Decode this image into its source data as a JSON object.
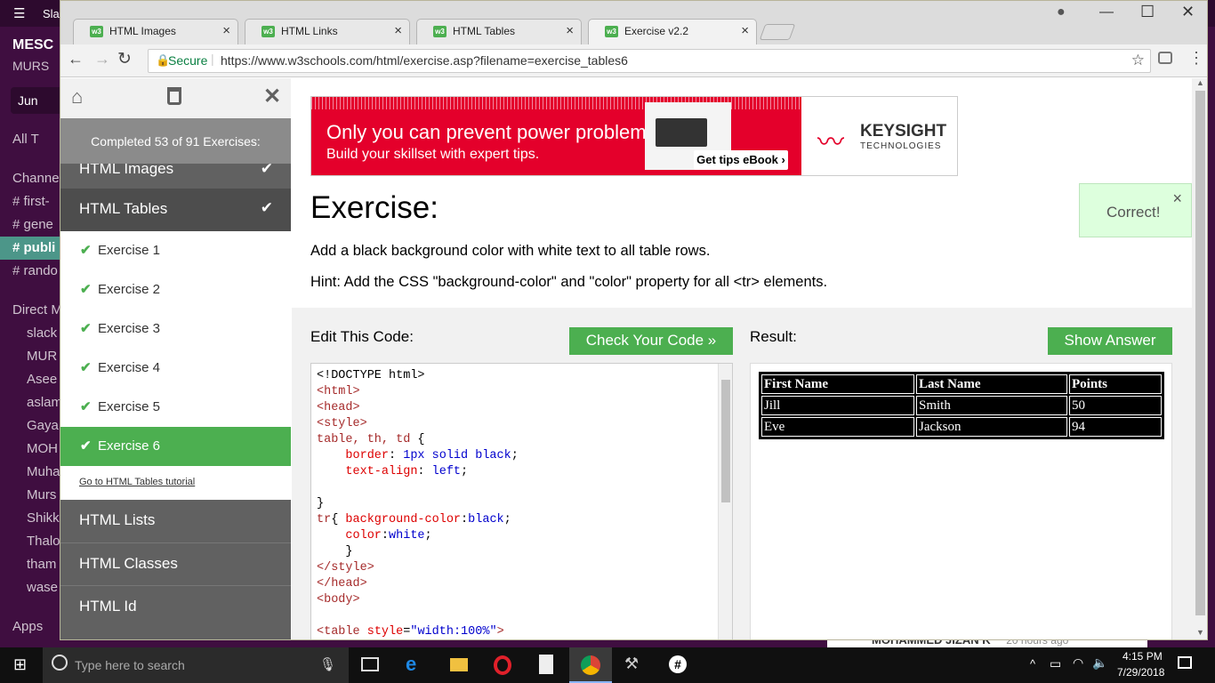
{
  "slack": {
    "workspace_title": "Sla",
    "team": "MESC",
    "user": "MURS",
    "jump": "Jun",
    "all_threads": "All T",
    "channels_header": "Channe",
    "channels": [
      "# first-",
      "# gene",
      "# publi",
      "# rando"
    ],
    "dm_header": "Direct M",
    "dms": [
      "slack",
      "MUR",
      "Asee",
      "aslam",
      "Gaya",
      "MOH",
      "Muha",
      "Murs",
      "Shikk",
      "Thalo",
      "tham",
      "wase"
    ],
    "apps": "Apps",
    "bottom_name": "MOHAMMED JIZAN K",
    "bottom_time": "20 hours ago"
  },
  "browser": {
    "tabs": [
      {
        "label": "HTML Images"
      },
      {
        "label": "HTML Links"
      },
      {
        "label": "HTML Tables"
      },
      {
        "label": "Exercise v2.2"
      }
    ],
    "secure_label": "Secure",
    "url": "https://www.w3schools.com/html/exercise.asp?filename=exercise_tables6"
  },
  "sidebar": {
    "completed": "Completed 53 of 91 Exercises:",
    "prev_section": "HTML Images",
    "current_section": "HTML Tables",
    "exercises": [
      "Exercise 1",
      "Exercise 2",
      "Exercise 3",
      "Exercise 4",
      "Exercise 5",
      "Exercise 6"
    ],
    "tutorial_link": "Go to HTML Tables tutorial",
    "next_sections": [
      "HTML Lists",
      "HTML Classes",
      "HTML Id"
    ]
  },
  "ad": {
    "headline": "Only you can prevent power problems.",
    "subline": "Build your skillset with expert tips.",
    "cta": "Get tips eBook ›",
    "brand": "KEYSIGHT",
    "brand_sub": "TECHNOLOGIES"
  },
  "exercise": {
    "heading": "Exercise:",
    "instruction": "Add a black background color with white text to all table rows.",
    "hint": "Hint: Add the CSS \"background-color\" and \"color\" property for all <tr> elements.",
    "correct": "Correct!",
    "edit_label": "Edit This Code:",
    "check_button": "Check Your Code »",
    "result_label": "Result:",
    "answer_button": "Show Answer"
  },
  "result_table": {
    "headers": [
      "First Name",
      "Last Name",
      "Points"
    ],
    "rows": [
      [
        "Jill",
        "Smith",
        "50"
      ],
      [
        "Eve",
        "Jackson",
        "94"
      ]
    ]
  },
  "taskbar": {
    "search_placeholder": "Type here to search",
    "time": "4:15 PM",
    "date": "7/29/2018"
  },
  "colors": {
    "w3_green": "#4caf50",
    "sidebar_dark": "#616161",
    "ad_red": "#e4002b",
    "slack_purple": "#3f0e40"
  }
}
